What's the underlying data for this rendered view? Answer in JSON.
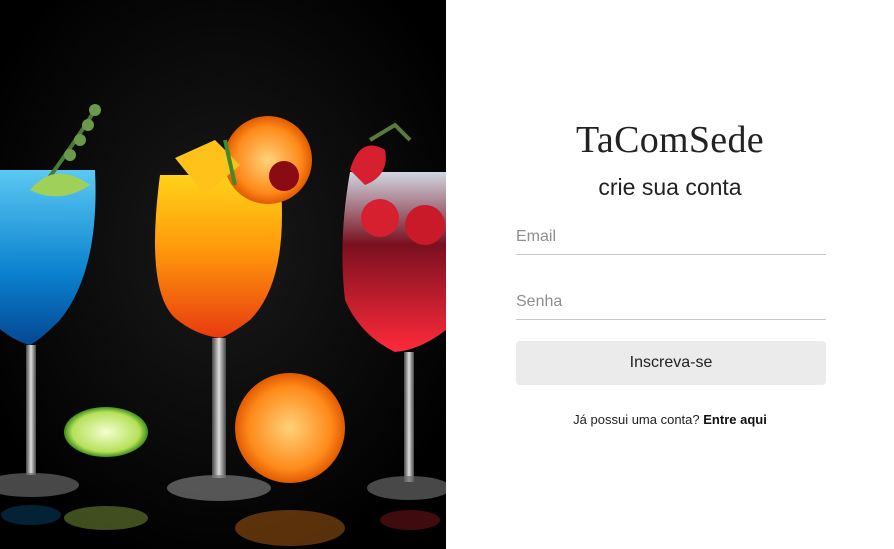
{
  "hero": {
    "image": "colorful-cocktail-glasses-photo"
  },
  "brand": {
    "title": "TaComSede"
  },
  "form": {
    "subtitle": "crie sua conta",
    "email_placeholder": "Email",
    "email_value": "",
    "password_placeholder": "Senha",
    "password_value": "",
    "submit_label": "Inscreva-se",
    "login_prompt": "Já possui uma conta?",
    "login_link": "Entre aqui"
  },
  "colors": {
    "panel_background": "#ffffff",
    "button_background": "#ebebeb",
    "text": "#222222",
    "placeholder": "#8f8f8f",
    "underline": "#c8c8c8"
  }
}
